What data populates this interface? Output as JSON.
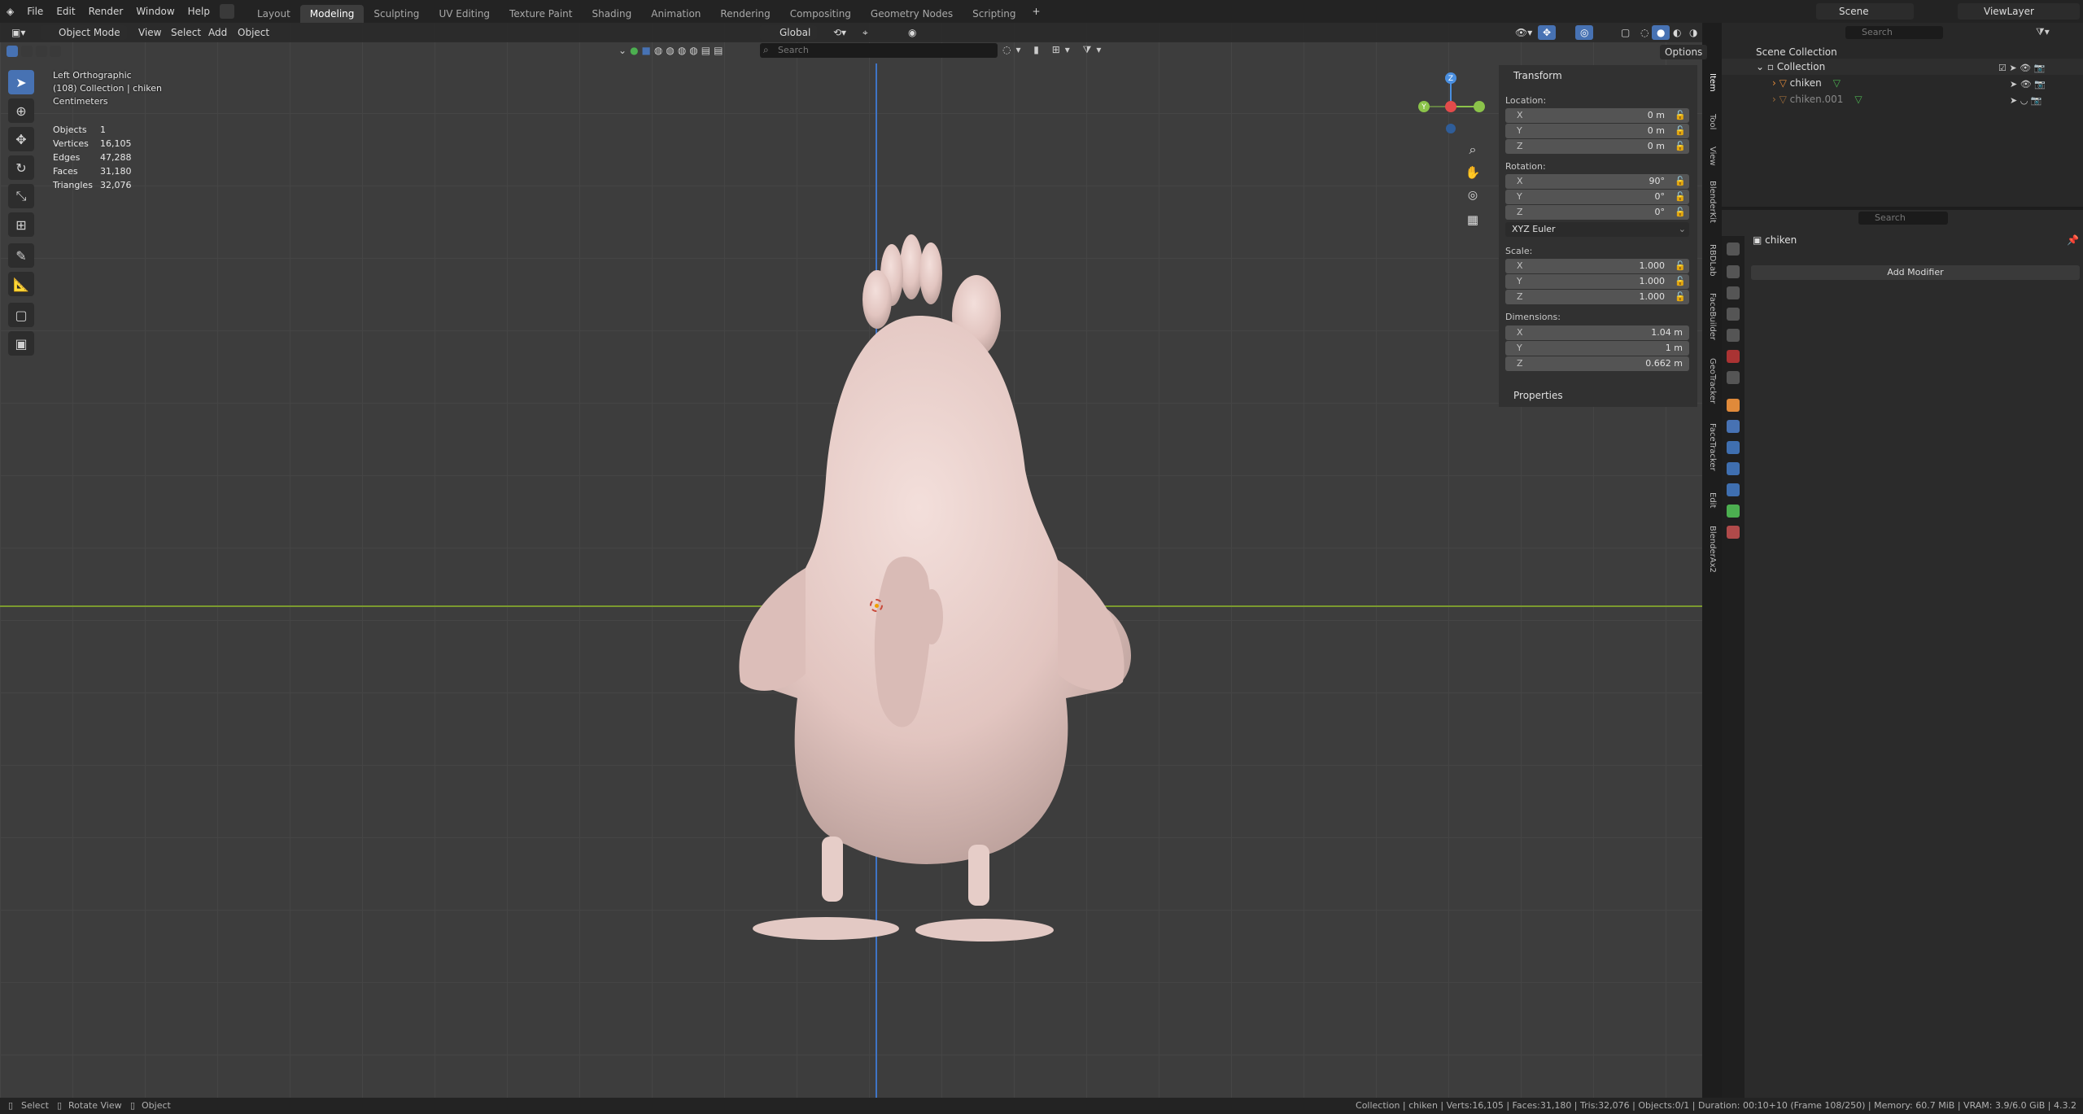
{
  "menu": {
    "file": "File",
    "edit": "Edit",
    "render": "Render",
    "window": "Window",
    "help": "Help"
  },
  "workspaces": [
    "Layout",
    "Modeling",
    "Sculpting",
    "UV Editing",
    "Texture Paint",
    "Shading",
    "Animation",
    "Rendering",
    "Compositing",
    "Geometry Nodes",
    "Scripting"
  ],
  "active_workspace": "Modeling",
  "scene": {
    "label": "Scene",
    "view_layer": "ViewLayer"
  },
  "viewport_header": {
    "mode": "Object Mode",
    "view": "View",
    "select": "Select",
    "add": "Add",
    "object": "Object",
    "orientation": "Global",
    "options": "Options",
    "search_placeholder": "Search"
  },
  "viewport_overlay": {
    "view_name": "Left Orthographic",
    "collection": "(108) Collection | chiken",
    "units": "Centimeters",
    "stats": [
      {
        "label": "Objects",
        "value": "1"
      },
      {
        "label": "Vertices",
        "value": "16,105"
      },
      {
        "label": "Edges",
        "value": "47,288"
      },
      {
        "label": "Faces",
        "value": "31,180"
      },
      {
        "label": "Triangles",
        "value": "32,076"
      }
    ]
  },
  "npanel": {
    "transform_title": "Transform",
    "location_label": "Location:",
    "location": [
      {
        "axis": "X",
        "value": "0 m"
      },
      {
        "axis": "Y",
        "value": "0 m"
      },
      {
        "axis": "Z",
        "value": "0 m"
      }
    ],
    "rotation_label": "Rotation:",
    "rotation": [
      {
        "axis": "X",
        "value": "90°"
      },
      {
        "axis": "Y",
        "value": "0°"
      },
      {
        "axis": "Z",
        "value": "0°"
      }
    ],
    "rotation_mode": "XYZ Euler",
    "scale_label": "Scale:",
    "scale": [
      {
        "axis": "X",
        "value": "1.000"
      },
      {
        "axis": "Y",
        "value": "1.000"
      },
      {
        "axis": "Z",
        "value": "1.000"
      }
    ],
    "dimensions_label": "Dimensions:",
    "dimensions": [
      {
        "axis": "X",
        "value": "1.04 m"
      },
      {
        "axis": "Y",
        "value": "1 m"
      },
      {
        "axis": "Z",
        "value": "0.662 m"
      }
    ],
    "properties_title": "Properties",
    "side_tabs": [
      "Item",
      "Tool",
      "View",
      "BlenderKit",
      "RBDLab",
      "FaceBuilder",
      "GeoTracker",
      "FaceTracker",
      "Edit",
      "BlenderAx2"
    ]
  },
  "outliner": {
    "search_placeholder": "Search",
    "scene_collection": "Scene Collection",
    "collection": "Collection",
    "objects": [
      "chiken",
      "chiken.001"
    ]
  },
  "properties": {
    "search_placeholder": "Search",
    "object_name": "chiken",
    "add_modifier": "Add Modifier"
  },
  "statusbar": {
    "select": "Select",
    "rotate_view": "Rotate View",
    "object": "Object",
    "info": "Collection | chiken | Verts:16,105 | Faces:31,180 | Tris:32,076 | Objects:0/1 | Duration: 00:10+10 (Frame 108/250) | Memory: 60.7 MiB | VRAM: 3.9/6.0 GiB | 4.3.2"
  },
  "colors": {
    "accent": "#4772b3",
    "x_axis": "#e34b4b",
    "y_axis": "#8bc34a",
    "z_axis": "#4a8fe0",
    "model": "#e3c9c4"
  }
}
